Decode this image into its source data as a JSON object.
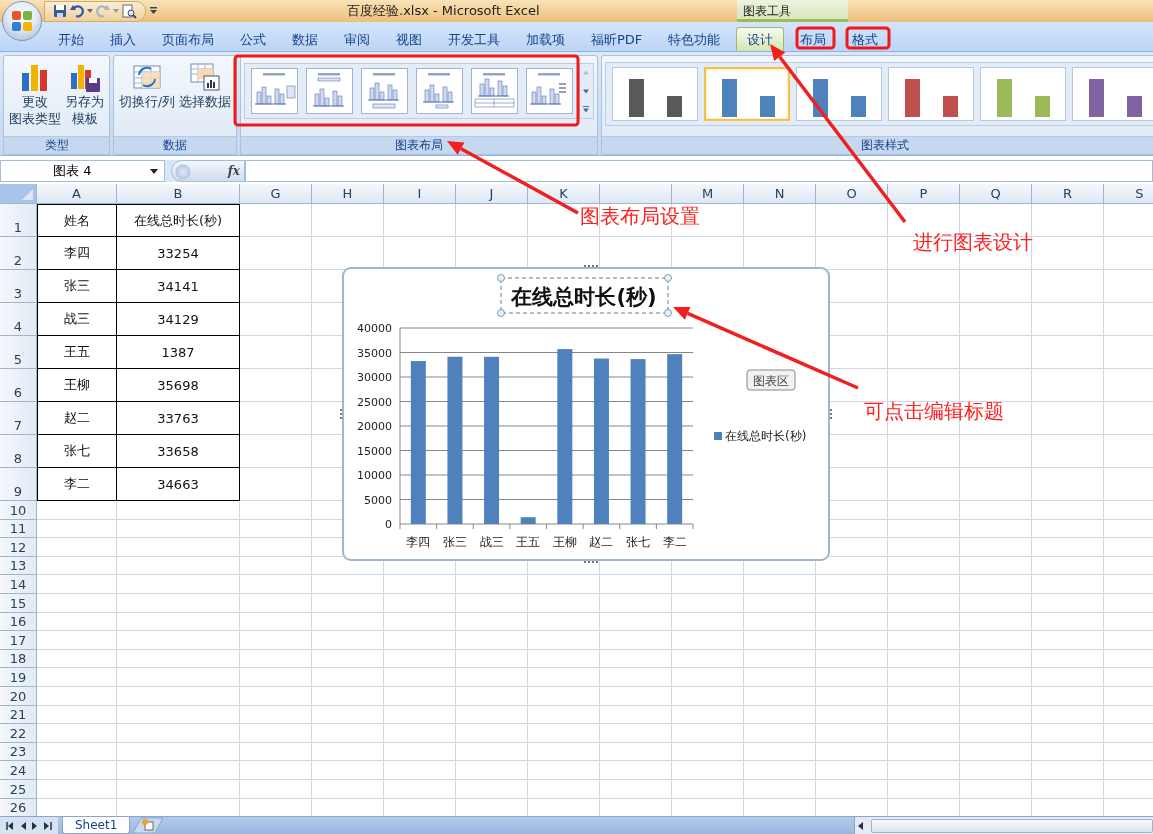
{
  "window": {
    "title": "百度经验.xlsx - Microsoft Excel",
    "context_title": "图表工具"
  },
  "tabs": [
    {
      "label": "开始",
      "selected": false,
      "kind": "main"
    },
    {
      "label": "插入",
      "selected": false,
      "kind": "main"
    },
    {
      "label": "页面布局",
      "selected": false,
      "kind": "main"
    },
    {
      "label": "公式",
      "selected": false,
      "kind": "main"
    },
    {
      "label": "数据",
      "selected": false,
      "kind": "main"
    },
    {
      "label": "审阅",
      "selected": false,
      "kind": "main"
    },
    {
      "label": "视图",
      "selected": false,
      "kind": "main"
    },
    {
      "label": "开发工具",
      "selected": false,
      "kind": "main"
    },
    {
      "label": "加载项",
      "selected": false,
      "kind": "main"
    },
    {
      "label": "福昕PDF",
      "selected": false,
      "kind": "main"
    },
    {
      "label": "特色功能",
      "selected": false,
      "kind": "main"
    },
    {
      "label": "设计",
      "selected": true,
      "kind": "context"
    },
    {
      "label": "布局",
      "selected": false,
      "kind": "context"
    },
    {
      "label": "格式",
      "selected": false,
      "kind": "context"
    }
  ],
  "ribbon": {
    "groups": [
      {
        "label": "类型",
        "kind": "buttons",
        "buttons": [
          {
            "lines": [
              "更改",
              "图表类型"
            ],
            "kind": "chart"
          },
          {
            "lines": [
              "另存为",
              "模板"
            ],
            "kind": "template"
          }
        ]
      },
      {
        "label": "数据",
        "kind": "buttons",
        "buttons": [
          {
            "lines": [
              "切换行/列"
            ],
            "kind": "switch"
          },
          {
            "lines": [
              "选择数据"
            ],
            "kind": "select"
          }
        ]
      },
      {
        "label": "图表布局",
        "kind": "layouts",
        "layouts": [
          {
            "kind": "right"
          },
          {
            "kind": "top"
          },
          {
            "kind": "bottom"
          },
          {
            "kind": "plain"
          },
          {
            "kind": "table"
          },
          {
            "kind": "labels"
          }
        ]
      },
      {
        "label": "图表样式",
        "kind": "styles",
        "styles": [
          {
            "color": "#595959",
            "selected": false
          },
          {
            "color": "#4f81bd",
            "selected": true
          },
          {
            "color": "#4f81bd",
            "selected": false
          },
          {
            "color": "#c0504d",
            "selected": false
          },
          {
            "color": "#9bbb59",
            "selected": false
          },
          {
            "color": "#8064a2",
            "selected": false
          }
        ]
      }
    ]
  },
  "formula_bar": {
    "name_box": "图表 4",
    "function_label": "fx"
  },
  "sheet": {
    "columns": [
      {
        "label": "A"
      },
      {
        "label": "B"
      },
      {
        "label": "G"
      },
      {
        "label": "H"
      },
      {
        "label": "I"
      },
      {
        "label": "J"
      },
      {
        "label": "K"
      },
      {
        "covered": true
      },
      {
        "label": "M"
      },
      {
        "label": "N"
      },
      {
        "label": "O"
      },
      {
        "label": "P"
      },
      {
        "label": "Q"
      },
      {
        "label": "R"
      },
      {
        "label": "S"
      }
    ],
    "rows": [
      {
        "number": "1",
        "cells": [
          "姓名",
          "在线总时长(秒)"
        ]
      },
      {
        "number": "2",
        "cells": [
          "李四",
          "33254"
        ]
      },
      {
        "number": "3",
        "cells": [
          "张三",
          "34141"
        ]
      },
      {
        "number": "4",
        "cells": [
          "战三",
          "34129"
        ]
      },
      {
        "number": "5",
        "cells": [
          "王五",
          "1387"
        ]
      },
      {
        "number": "6",
        "cells": [
          "王柳",
          "35698"
        ]
      },
      {
        "number": "7",
        "cells": [
          "赵二",
          "33763"
        ]
      },
      {
        "number": "8",
        "cells": [
          "张七",
          "33658"
        ]
      },
      {
        "number": "9",
        "cells": [
          "李二",
          "34663"
        ]
      },
      {
        "number": "10"
      },
      {
        "number": "11"
      },
      {
        "number": "12"
      },
      {
        "number": "13"
      },
      {
        "number": "14"
      },
      {
        "number": "15"
      },
      {
        "number": "16"
      },
      {
        "number": "17"
      },
      {
        "number": "18"
      },
      {
        "number": "19"
      },
      {
        "number": "20"
      },
      {
        "number": "21"
      },
      {
        "number": "22"
      },
      {
        "number": "23"
      },
      {
        "number": "24"
      },
      {
        "number": "25"
      },
      {
        "number": "26"
      }
    ]
  },
  "chart": {
    "tooltip": "图表区",
    "title_selected": true,
    "chart_data": {
      "type": "bar",
      "title": "在线总时长(秒)",
      "categories": [
        "李四",
        "张三",
        "战三",
        "王五",
        "王柳",
        "赵二",
        "张七",
        "李二"
      ],
      "series": [
        {
          "name": "在线总时长(秒)",
          "color": "#4f81bd",
          "values": [
            33254,
            34141,
            34129,
            1387,
            35698,
            33763,
            33658,
            34663
          ]
        }
      ],
      "grid": true,
      "ylim": [
        0,
        40000
      ],
      "yticks": [
        0,
        5000,
        10000,
        15000,
        20000,
        25000,
        30000,
        35000,
        40000
      ]
    }
  },
  "sheet_tabs": [
    {
      "label": "Sheet1",
      "selected": true
    }
  ],
  "annotations": [
    {
      "text": "图表布局设置"
    },
    {
      "text": "进行图表设计"
    },
    {
      "text": "可点击编辑标题"
    }
  ]
}
